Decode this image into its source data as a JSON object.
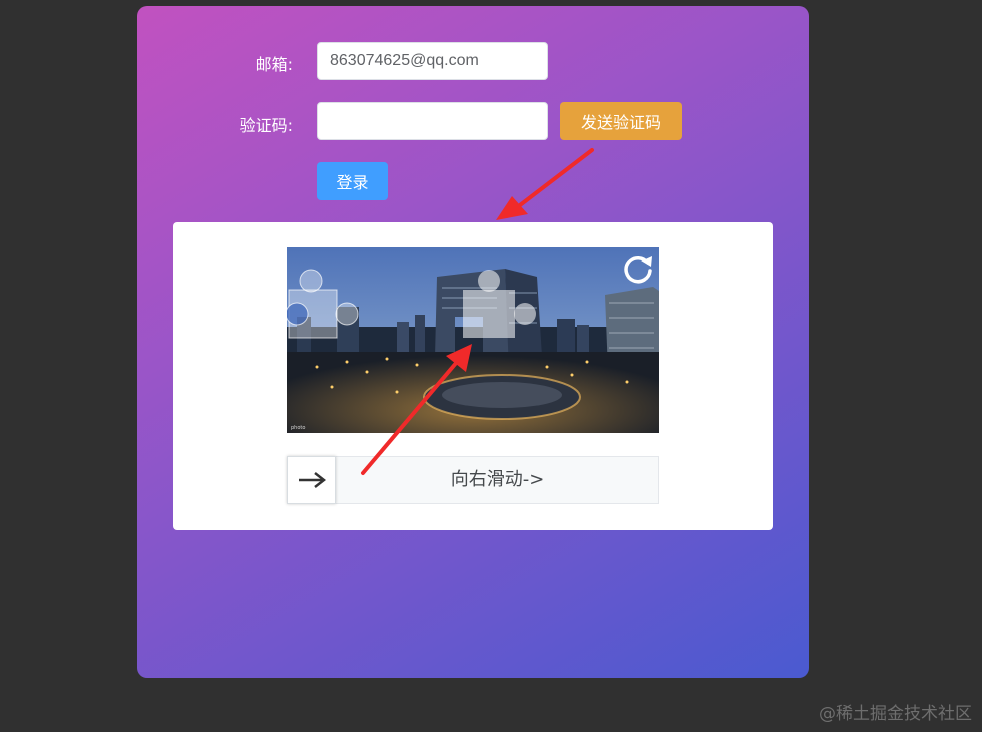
{
  "form": {
    "email_label": "邮箱:",
    "email_value": "863074625@qq.com",
    "code_label": "验证码:",
    "code_value": "",
    "send_code_label": "发送验证码",
    "login_label": "登录"
  },
  "captcha": {
    "refresh_icon": "refresh-icon",
    "slider_text": "向右滑动->",
    "handle_icon": "arrow-right-icon"
  },
  "watermark": "@稀土掘金技术社区",
  "colors": {
    "send_button": "#e6a23c",
    "login_button": "#409eff",
    "arrow": "#f02a2a"
  }
}
